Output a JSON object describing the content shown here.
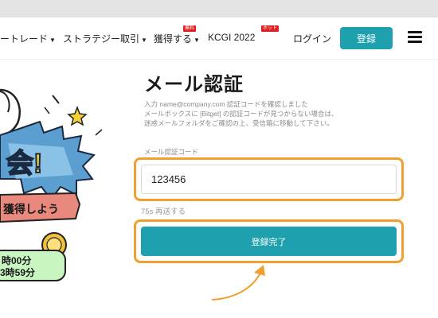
{
  "nav": {
    "items": [
      {
        "label": "ートレード"
      },
      {
        "label": "ストラテジー取引"
      },
      {
        "label": "獲得する",
        "badge": "無料"
      },
      {
        "label": "KCGI 2022",
        "badge": "ホット"
      }
    ],
    "login": "ログイン",
    "signup": "登録"
  },
  "promo": {
    "headline": "会!",
    "ribbon": "獲得しよう",
    "timer_line1": "時00分",
    "timer_line2": "3時59分"
  },
  "form": {
    "title": "メール認証",
    "desc_line1": "入力 name@company.com 認証コードを確認しました",
    "desc_line2": "メールボックスに [Bitget] の認証コードが見つからない場合は、",
    "desc_line3": "迷惑メールフォルダをご確認の上、受信箱に移動して下さい。",
    "field_label": "メール認証コード",
    "code_value": "123456",
    "resend": "75s 再送する",
    "submit": "登録完了"
  },
  "colors": {
    "accent": "#1ea0ae",
    "highlight": "#f0a030",
    "badge": "#e02020"
  }
}
